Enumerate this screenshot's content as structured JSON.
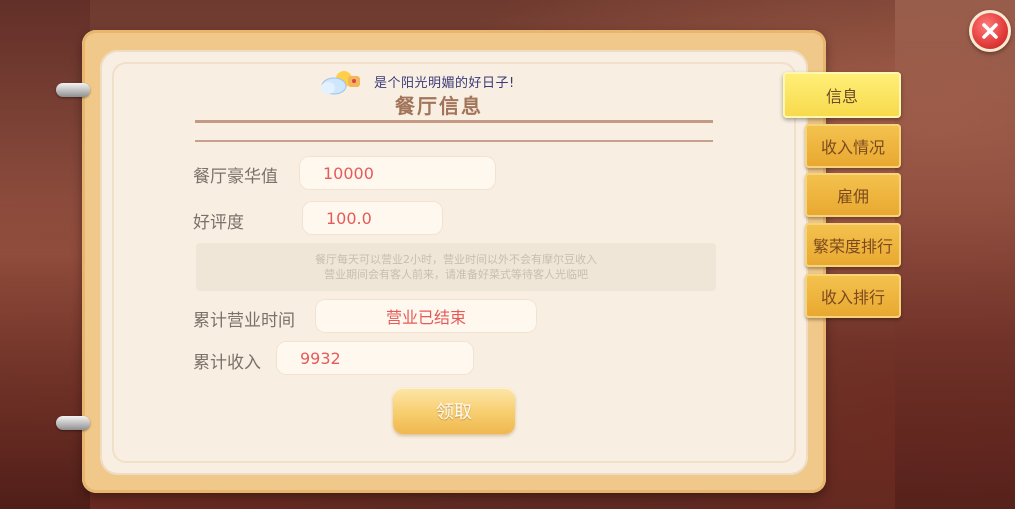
{
  "header": {
    "weather_text": "是个阳光明媚的好日子!",
    "title": "餐厅信息"
  },
  "stats": {
    "luxury_label": "餐厅豪华值",
    "luxury_value": "10000",
    "rating_label": "好评度",
    "rating_value": "100.0",
    "notice_line1": "餐厅每天可以营业2小时，营业时间以外不会有摩尔豆收入",
    "notice_line2": "营业期间会有客人前来，请准备好菜式等待客人光临吧",
    "business_time_label": "累计营业时间",
    "business_time_value": "营业已结束",
    "income_label": "累计收入",
    "income_value": "9932"
  },
  "actions": {
    "claim_label": "领取"
  },
  "tabs": [
    {
      "label": "信息",
      "active": true
    },
    {
      "label": "收入情况",
      "active": false
    },
    {
      "label": "雇佣",
      "active": false
    },
    {
      "label": "繁荣度排行",
      "active": false
    },
    {
      "label": "收入排行",
      "active": false
    }
  ],
  "colors": {
    "value_red": "#e65a5a",
    "tab_gold": "#f4c34f",
    "tab_active": "#fff07a",
    "close_red": "#e23b3b"
  },
  "icons": {
    "close": "close-icon",
    "weather": "sun-cloud-icon"
  }
}
